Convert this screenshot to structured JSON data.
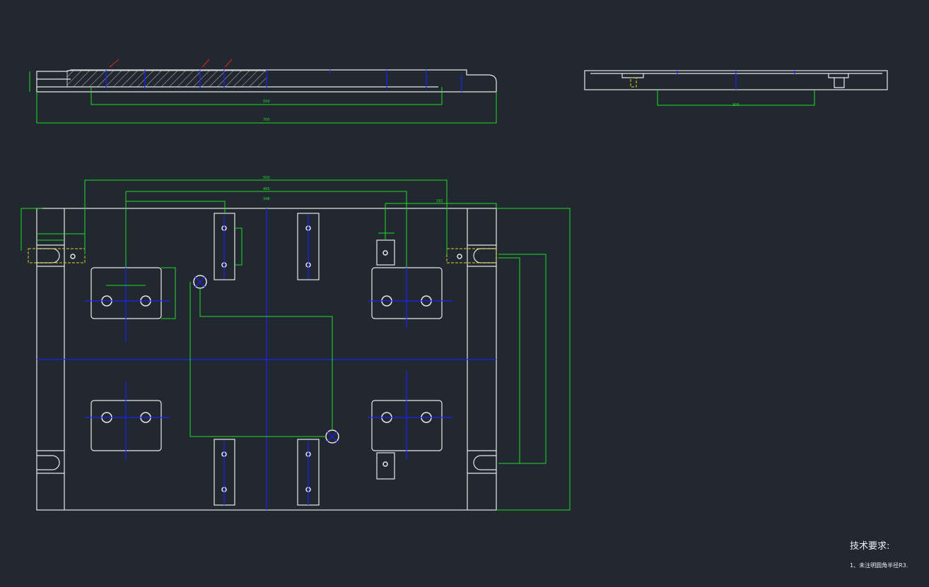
{
  "notes": {
    "title": "技术要求:",
    "items": [
      "1、未注明圆角半径R3."
    ]
  },
  "colors": {
    "background": "#212830",
    "outline": "#e8e8e8",
    "dimension": "#22dd22",
    "centerline": "#2020ff",
    "hidden": "#e0d020",
    "surface_finish": "#ee2222"
  }
}
